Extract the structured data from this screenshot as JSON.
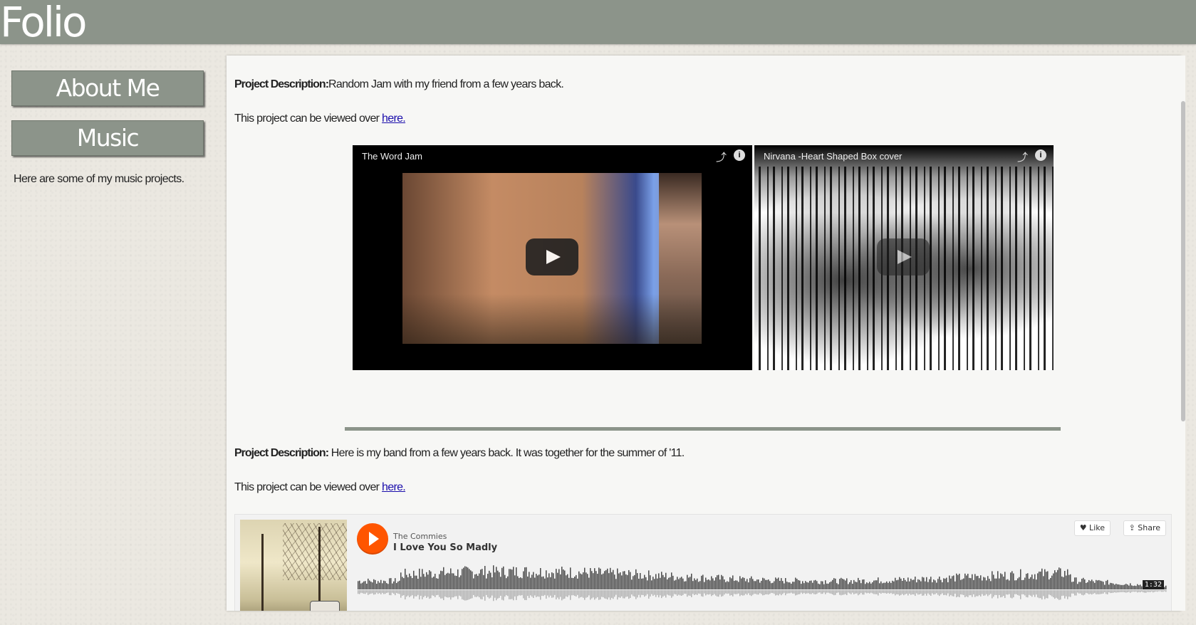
{
  "header": {
    "brand": "Folio"
  },
  "sidebar": {
    "nav": [
      {
        "label": "About Me"
      },
      {
        "label": "Music"
      }
    ],
    "intro": "Here are some of my music projects."
  },
  "main": {
    "projects": [
      {
        "desc_label": "Project Description:",
        "desc_text": "Random Jam with my friend from a few years back.",
        "view_prefix": "This project can be viewed over ",
        "view_link": "here."
      },
      {
        "desc_label": "Project Description:",
        "desc_text": " Here is my band from a few years back. It was together for the summer of '11.",
        "view_prefix": "This project can be viewed over ",
        "view_link": "here."
      }
    ],
    "videos": [
      {
        "title": "The Word Jam"
      },
      {
        "title": "Nirvana -Heart Shaped Box cover"
      }
    ],
    "soundcloud": {
      "artist": "The Commies",
      "track": "I Love You So Madly",
      "like_label": "♥ Like",
      "share_label": "⇪ Share",
      "duration": "1:32",
      "accent": "#ff5500"
    }
  },
  "colors": {
    "header_bg": "#8c948a",
    "page_bg": "#ebe8e1",
    "panel_bg": "#f7f7f5",
    "link": "#1a0dab"
  }
}
